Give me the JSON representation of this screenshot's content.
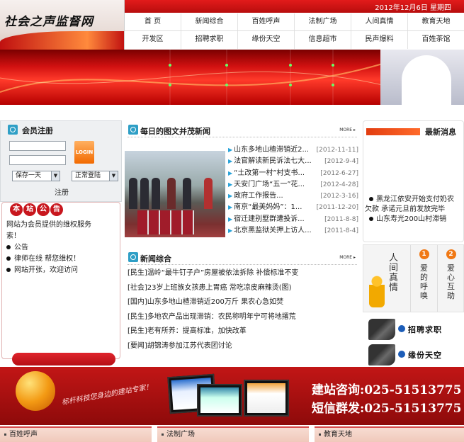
{
  "header": {
    "logo_text": "社会之声监督网",
    "date": "2012年12月6日 星期四",
    "nav_row1": [
      "首 页",
      "新闻综合",
      "百姓呼声",
      "法制广场",
      "人间真情",
      "教育天地"
    ],
    "nav_row2": [
      "开发区",
      "招聘求职",
      "缘份天空",
      "信息超市",
      "民声爆料",
      "百姓茶馆"
    ]
  },
  "member": {
    "title": "会员注册",
    "login_label": "LOGIN",
    "save_option": "保存一天",
    "login_mode": "正常登陆",
    "register_label": "注册"
  },
  "notice": {
    "title_chars": [
      "本",
      "站",
      "公",
      "告"
    ],
    "items": [
      {
        "text": "网站为会员提供的维权服务",
        "bullet": false
      },
      {
        "text": "索！",
        "bullet": false
      },
      {
        "text": "公告",
        "bullet": true
      },
      {
        "text": "律师在线 帮您维权！",
        "bullet": true
      },
      {
        "text": "网站开张，欢迎访问",
        "bullet": true
      }
    ]
  },
  "photo_news": {
    "title": "每日的图文并茂新闻",
    "more": "MORE ▸",
    "items": [
      {
        "title": "山东多地山楂滞销近2...",
        "date": "[2012-11-11]"
      },
      {
        "title": "法官解读新民诉法七大...",
        "date": "[2012-9-4]"
      },
      {
        "title": "“土改第一村”村支书...",
        "date": "[2012-6-27]"
      },
      {
        "title": "天安门广场“五一”花...",
        "date": "[2012-4-28]"
      },
      {
        "title": "政府工作报告...",
        "date": "[2012-3-16]"
      },
      {
        "title": "南京“最美妈妈”：1...",
        "date": "[2011-12-20]"
      },
      {
        "title": "宿迁建别墅群遭投诉...",
        "date": "[2011-8-8]"
      },
      {
        "title": "北京黑监狱关押上访人...",
        "date": "[2011-8-4]"
      }
    ]
  },
  "general_news": {
    "title": "新闻综合",
    "more": "MORE ▸",
    "items": [
      "[民生]温岭“最牛钉子户”房屋被依法拆除 补偿标准不变",
      "[社会]23岁上班族女孩患上胃癌 常吃凉皮麻辣烫(图)",
      "[国内]山东多地山楂滞销近200万斤 果农心急如焚",
      "[民生]多地农产品出现滞销：农民称明年宁可将地撂荒",
      "[民生]老有所养：提高标准，加快改革",
      "[要闻]胡锦涛参加江苏代表团讨论"
    ]
  },
  "latest": {
    "title": "最新消息",
    "items": [
      {
        "text": "黑龙江依安开始支付奶农",
        "bullet": true
      },
      {
        "text": "欠款 承诺元旦前发放完毕",
        "bullet": false
      },
      {
        "text": "山东寿光200山村滞销",
        "bullet": true
      }
    ]
  },
  "care": {
    "main": [
      "人",
      "间",
      "真",
      "情"
    ],
    "col2": {
      "num": "1",
      "chars": [
        "爱",
        "的",
        "呼",
        "唤"
      ]
    },
    "col3": {
      "num": "2",
      "chars": [
        "爱",
        "心",
        "互",
        "助"
      ]
    }
  },
  "side_links": [
    "招聘求职",
    "缘份天空"
  ],
  "ad": {
    "slogan": "标杆科技您身边的建站专家！",
    "line1": "建站咨询:025-51513775",
    "line2": "短信群发:025-51513775"
  },
  "bottom_bars": [
    "百姓呼声",
    "法制广场",
    "教育天地"
  ],
  "colors": {
    "brand_red": "#c8161d",
    "accent_blue": "#27a2d8",
    "accent_orange": "#f07814"
  }
}
